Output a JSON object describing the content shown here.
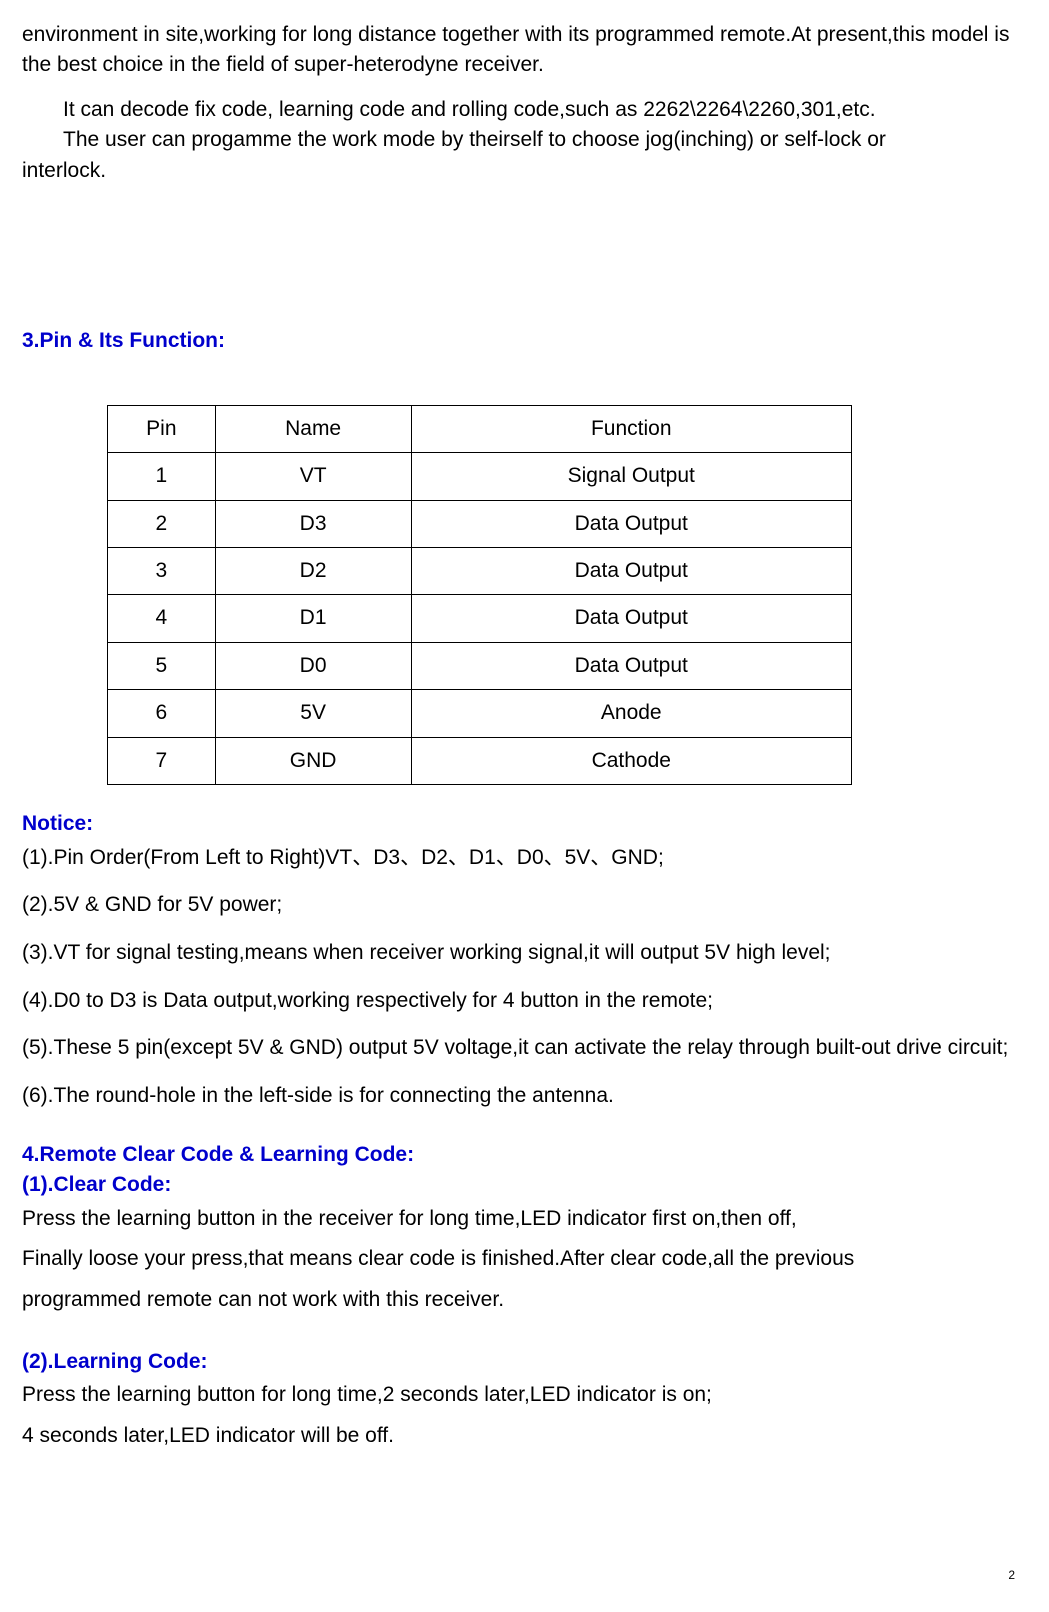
{
  "intro": {
    "p1": "environment in site,working for long distance together with its programmed remote.At present,this model is the best choice in the field of super-heterodyne receiver.",
    "p2": "It can decode fix code, learning code and rolling code,such as 2262\\2264\\2260,301,etc.",
    "p3": "The user can progamme the work mode by theirself to choose jog(inching) or self-lock or",
    "p3cont": "interlock."
  },
  "section3": {
    "heading": "3.Pin & Its Function:",
    "table": {
      "headers": [
        "Pin",
        "Name",
        "Function"
      ],
      "rows": [
        [
          "1",
          "VT",
          "Signal Output"
        ],
        [
          "2",
          "D3",
          "Data Output"
        ],
        [
          "3",
          "D2",
          "Data Output"
        ],
        [
          "4",
          "D1",
          "Data Output"
        ],
        [
          "5",
          "D0",
          "Data Output"
        ],
        [
          "6",
          "5V",
          "Anode"
        ],
        [
          "7",
          "GND",
          "Cathode"
        ]
      ]
    }
  },
  "notice": {
    "heading": "Notice:",
    "items": [
      "(1).Pin Order(From Left to Right)VT、D3、D2、D1、D0、5V、GND;",
      "(2).5V  & GND for 5V power;",
      "(3).VT for signal testing,means when receiver working signal,it will output 5V high level;",
      "(4).D0 to D3 is Data output,working respectively for 4 button in the remote;",
      "(5).These 5 pin(except 5V & GND) output 5V voltage,it can activate the relay through built-out drive circuit;",
      "(6).The round-hole in the left-side is for connecting the antenna."
    ]
  },
  "section4": {
    "heading": "4.Remote Clear Code & Learning Code:",
    "sub1": {
      "heading": "(1).Clear Code:",
      "body": [
        "Press the learning button in the receiver for long time,LED indicator first on,then off,",
        "Finally loose your press,that means clear code is finished.After clear code,all the previous",
        "programmed remote can not work with this receiver."
      ]
    },
    "sub2": {
      "heading": "(2).Learning Code:",
      "body": [
        "Press the learning button for long time,2 seconds later,LED indicator is on;",
        "4 seconds later,LED indicator will be off."
      ]
    }
  },
  "pageNumber": "2"
}
